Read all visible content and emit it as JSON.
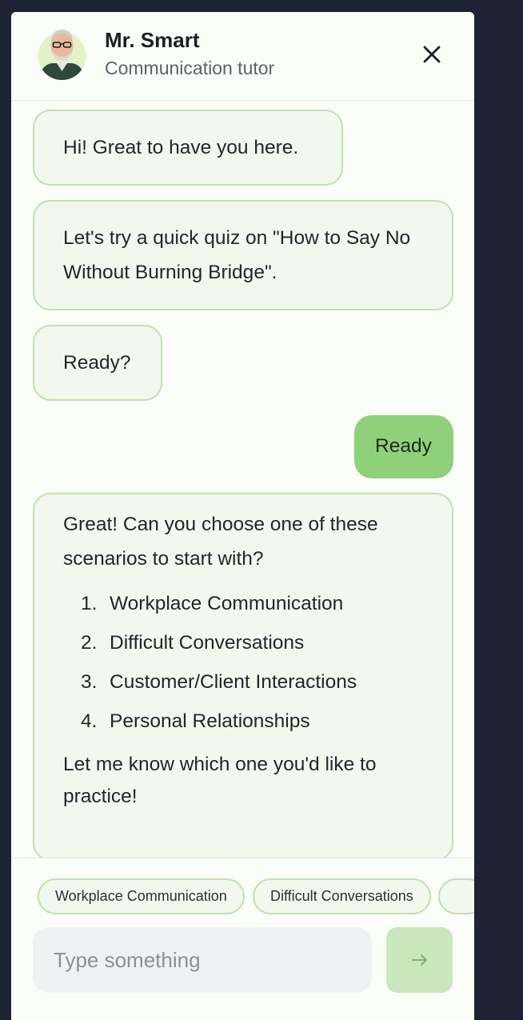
{
  "header": {
    "name": "Mr. Smart",
    "role": "Communication tutor"
  },
  "messages": [
    {
      "from": "bot",
      "text": "Hi! Great to have you here."
    },
    {
      "from": "bot",
      "text": "Let's try a quick quiz on \"How to Say No Without Burning Bridge\"."
    },
    {
      "from": "bot",
      "text": "Ready?"
    },
    {
      "from": "user",
      "text": "Ready"
    },
    {
      "from": "bot",
      "intro": "Great! Can you choose one of these scenarios to start with?",
      "options": [
        {
          "num": "1.",
          "label": "Workplace Communication"
        },
        {
          "num": "2.",
          "label": "Difficult Conversations"
        },
        {
          "num": "3.",
          "label": "Customer/Client Interactions"
        },
        {
          "num": "4.",
          "label": "Personal Relationships"
        }
      ],
      "outro": "Let me know which one you'd like to practice!"
    }
  ],
  "suggestions": [
    "Workplace Communication",
    "Difficult Conversations",
    ""
  ],
  "composer": {
    "placeholder": "Type something",
    "send_icon": "arrow-right-icon"
  },
  "colors": {
    "background": "#1e2333",
    "panel": "#fbfdf8",
    "bot_bubble": "#f2f8ee",
    "bot_border": "#bfe2ad",
    "user_bubble": "#8fd07a",
    "send_button": "#c8e8bc"
  }
}
